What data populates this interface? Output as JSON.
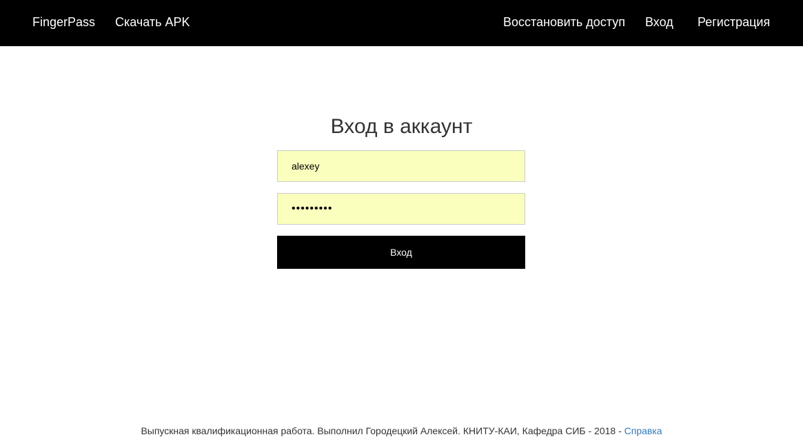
{
  "navbar": {
    "brand": "FingerPass",
    "download_apk": "Скачать APK",
    "recover_access": "Восстановить доступ",
    "login": "Вход",
    "register": "Регистрация"
  },
  "form": {
    "title": "Вход в аккаунт",
    "username_value": "alexey",
    "password_value": "abcdefghi",
    "submit_label": "Вход"
  },
  "footer": {
    "text": "Выпускная квалификационная работа. Выполнил Городецкий Алексей. КНИТУ-КАИ, Кафедра СИБ - 2018 - ",
    "help_link": "Справка"
  },
  "colors": {
    "navbar_bg": "#000000",
    "autofill_bg": "#faffbd",
    "link": "#337ab7"
  }
}
